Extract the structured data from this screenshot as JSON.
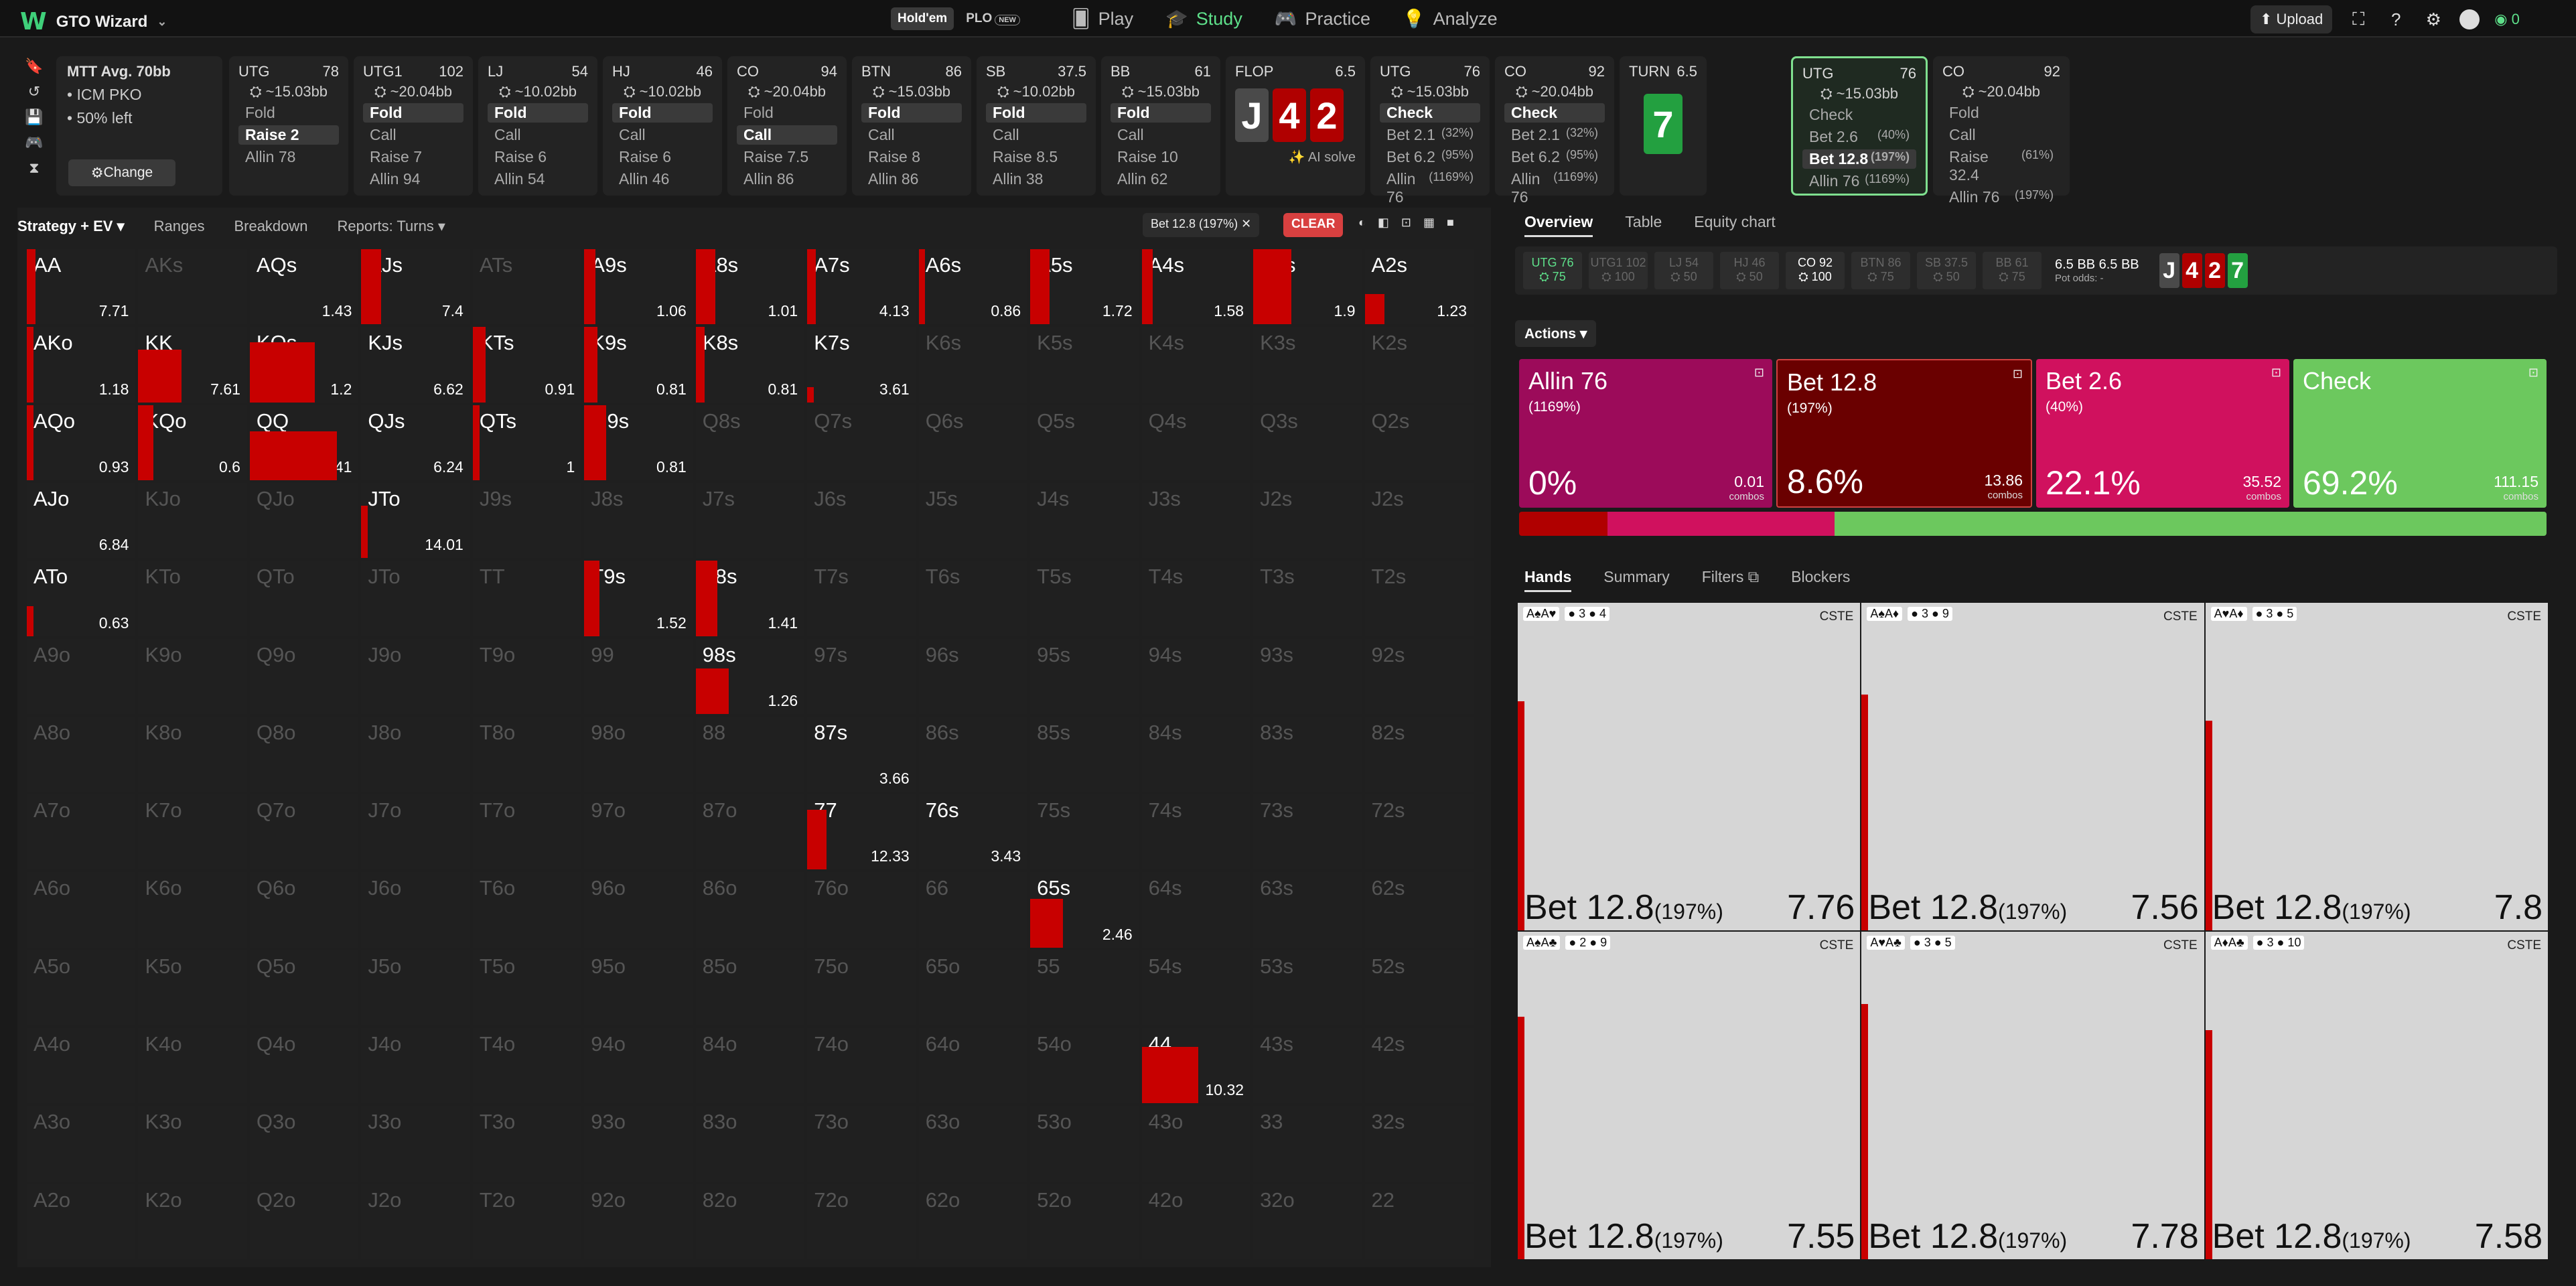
{
  "app": {
    "name": "GTO Wizard"
  },
  "gametype": {
    "holdem": "Hold'em",
    "plo": "PLO",
    "plo_tag": "NEW"
  },
  "nav": {
    "play": "Play",
    "study": "Study",
    "practice": "Practice",
    "analyze": "Analyze"
  },
  "topright": {
    "upload": "Upload",
    "coins": "0"
  },
  "mtt": {
    "title": "MTT Avg. 70bb",
    "line1": "ICM PKO",
    "line2": "50% left",
    "change": "Change"
  },
  "seats": [
    {
      "pos": "UTG",
      "num": "78",
      "stack": "~15.03bb",
      "opts": [
        {
          "l": "Fold"
        },
        {
          "l": "Raise 2",
          "sel": true
        },
        {
          "l": "Allin 78"
        }
      ]
    },
    {
      "pos": "UTG1",
      "num": "102",
      "stack": "~20.04bb",
      "opts": [
        {
          "l": "Fold",
          "sel": true
        },
        {
          "l": "Call"
        },
        {
          "l": "Raise 7"
        },
        {
          "l": "Allin 94"
        }
      ]
    },
    {
      "pos": "LJ",
      "num": "54",
      "stack": "~10.02bb",
      "opts": [
        {
          "l": "Fold",
          "sel": true
        },
        {
          "l": "Call"
        },
        {
          "l": "Raise 6"
        },
        {
          "l": "Allin 54"
        }
      ]
    },
    {
      "pos": "HJ",
      "num": "46",
      "stack": "~10.02bb",
      "opts": [
        {
          "l": "Fold",
          "sel": true
        },
        {
          "l": "Call"
        },
        {
          "l": "Raise 6"
        },
        {
          "l": "Allin 46"
        }
      ]
    },
    {
      "pos": "CO",
      "num": "94",
      "stack": "~20.04bb",
      "opts": [
        {
          "l": "Fold"
        },
        {
          "l": "Call",
          "sel": true
        },
        {
          "l": "Raise 7.5"
        },
        {
          "l": "Allin 86"
        }
      ]
    },
    {
      "pos": "BTN",
      "num": "86",
      "stack": "~15.03bb",
      "opts": [
        {
          "l": "Fold",
          "sel": true
        },
        {
          "l": "Call"
        },
        {
          "l": "Raise 8"
        },
        {
          "l": "Allin 86"
        }
      ]
    },
    {
      "pos": "SB",
      "num": "37.5",
      "stack": "~10.02bb",
      "opts": [
        {
          "l": "Fold",
          "sel": true
        },
        {
          "l": "Call"
        },
        {
          "l": "Raise 8.5"
        },
        {
          "l": "Allin 38"
        }
      ]
    },
    {
      "pos": "BB",
      "num": "61",
      "stack": "~15.03bb",
      "opts": [
        {
          "l": "Fold",
          "sel": true
        },
        {
          "l": "Call"
        },
        {
          "l": "Raise 10"
        },
        {
          "l": "Allin 62"
        }
      ]
    }
  ],
  "flop": {
    "label": "FLOP",
    "pot": "6.5",
    "cards": [
      "J",
      "4",
      "2"
    ],
    "aisolve": "AI solve"
  },
  "seats2": [
    {
      "pos": "UTG",
      "num": "76",
      "stack": "~15.03bb",
      "opts": [
        {
          "l": "Check",
          "sel": true
        },
        {
          "l": "Bet 2.1",
          "p": "(32%)"
        },
        {
          "l": "Bet 6.2",
          "p": "(95%)"
        },
        {
          "l": "Allin 76",
          "p": "(1169%)"
        }
      ]
    },
    {
      "pos": "CO",
      "num": "92",
      "stack": "~20.04bb",
      "opts": [
        {
          "l": "Check",
          "sel": true
        },
        {
          "l": "Bet 2.1",
          "p": "(32%)"
        },
        {
          "l": "Bet 6.2",
          "p": "(95%)"
        },
        {
          "l": "Allin 76",
          "p": "(1169%)"
        }
      ]
    }
  ],
  "turn": {
    "label": "TURN",
    "pot": "6.5",
    "card": "7"
  },
  "seats3": [
    {
      "pos": "UTG",
      "num": "76",
      "stack": "~15.03bb",
      "active": true,
      "opts": [
        {
          "l": "Check"
        },
        {
          "l": "Bet 2.6",
          "p": "(40%)"
        },
        {
          "l": "Bet 12.8",
          "p": "(197%)",
          "sel": true
        },
        {
          "l": "Allin 76",
          "p": "(1169%)"
        }
      ]
    },
    {
      "pos": "CO",
      "num": "92",
      "stack": "~20.04bb",
      "opts": [
        {
          "l": "Fold"
        },
        {
          "l": "Call"
        },
        {
          "l": "Raise 32.4",
          "p": "(61%)"
        },
        {
          "l": "Allin 76",
          "p": "(197%)"
        }
      ]
    }
  ],
  "lefttabs": {
    "strategy": "Strategy + EV",
    "ranges": "Ranges",
    "breakdown": "Breakdown",
    "reports": "Reports: Turns"
  },
  "filterchip": "Bet 12.8 (197%)",
  "clear": "CLEAR",
  "grid": [
    [
      "AA:7.71:100:8",
      "AKs",
      "AQs:1.43",
      "AJs:7.4:100:18",
      "ATs",
      "A9s:1.06:100:10",
      "A8s:1.01:100:18",
      "A7s:4.13:100:8",
      "A6s:0.86:100:6",
      "A5s:1.72:100:18",
      "A4s:1.58:100:10",
      "A3s:1.9:100:35",
      "A2s:1.23:40:18"
    ],
    [
      "AKo:1.18:100:6",
      "KK:7.61:70:40",
      "KQs:1.2:80:60",
      "KJs:6.62",
      "KTs:0.91:100:12",
      "K9s:0.81:100:12",
      "K8s:0.81:100:8",
      "K7s:3.61:20:6",
      "K6s",
      "K5s",
      "K4s",
      "K3s",
      "K2s"
    ],
    [
      "AQo:0.93:100:6",
      "KQo:0.6:100:14",
      "QQ:7.41:65:80",
      "QJs:6.24",
      "QTs:1:100:6",
      "Q9s:0.81:100:20",
      "Q8s",
      "Q7s",
      "Q6s",
      "Q5s",
      "Q4s",
      "Q3s",
      "Q2s"
    ],
    [
      "AJo:6.84",
      "KJo",
      "QJo",
      "JTo:14.01:70:6",
      "J9s",
      "J8s",
      "J7s",
      "J6s",
      "J5s",
      "J4s",
      "J3s",
      "J2s",
      "J2s"
    ],
    [
      "ATo:0.63:40:6",
      "KTo",
      "QTo",
      "JTo",
      "TT",
      "T9s:1.52:100:14",
      "T8s:1.41:100:20",
      "T7s",
      "T6s",
      "T5s",
      "T4s",
      "T3s",
      "T2s"
    ],
    [
      "A9o",
      "K9o",
      "Q9o",
      "J9o",
      "T9o",
      "99",
      "98s:1.26:60:30",
      "97s",
      "96s",
      "95s",
      "94s",
      "93s",
      "92s"
    ],
    [
      "A8o",
      "K8o",
      "Q8o",
      "J8o",
      "T8o",
      "98o",
      "88",
      "87s:3.66",
      "86s",
      "85s",
      "84s",
      "83s",
      "82s"
    ],
    [
      "A7o",
      "K7o",
      "Q7o",
      "J7o",
      "T7o",
      "97o",
      "87o",
      "77:12.33:80:18",
      "76s:3.43",
      "75s",
      "74s",
      "73s",
      "72s"
    ],
    [
      "A6o",
      "K6o",
      "Q6o",
      "J6o",
      "T6o",
      "96o",
      "86o",
      "76o",
      "66",
      "65s:2.46:65:30",
      "64s",
      "63s",
      "62s"
    ],
    [
      "A5o",
      "K5o",
      "Q5o",
      "J5o",
      "T5o",
      "95o",
      "85o",
      "75o",
      "65o",
      "55",
      "54s",
      "53s",
      "52s"
    ],
    [
      "A4o",
      "K4o",
      "Q4o",
      "J4o",
      "T4o",
      "94o",
      "84o",
      "74o",
      "64o",
      "54o",
      "44:10.32:75:52",
      "43s",
      "42s"
    ],
    [
      "A3o",
      "K3o",
      "Q3o",
      "J3o",
      "T3o",
      "93o",
      "83o",
      "73o",
      "63o",
      "53o",
      "43o",
      "33",
      "32s"
    ],
    [
      "A2o",
      "K2o",
      "Q2o",
      "J2o",
      "T2o",
      "92o",
      "82o",
      "72o",
      "62o",
      "52o",
      "42o",
      "32o",
      "22"
    ]
  ],
  "righttabs": {
    "overview": "Overview",
    "table": "Table",
    "equity": "Equity chart"
  },
  "strip": [
    {
      "p": "UTG 76",
      "s": "75",
      "cls": "utg"
    },
    {
      "p": "UTG1 102",
      "s": "100"
    },
    {
      "p": "LJ 54",
      "s": "50"
    },
    {
      "p": "HJ 46",
      "s": "50"
    },
    {
      "p": "CO 92",
      "s": "100",
      "cls": "on"
    },
    {
      "p": "BTN 86",
      "s": "75"
    },
    {
      "p": "SB 37.5",
      "s": "50"
    },
    {
      "p": "BB 61",
      "s": "75"
    }
  ],
  "pot": {
    "a": "6.5 BB",
    "b": "6.5 BB",
    "odds": "Pot odds: -"
  },
  "board": [
    "J",
    "4",
    "2",
    "7"
  ],
  "actions_label": "Actions",
  "action_cards": [
    {
      "name": "Allin 76",
      "sub": "(1169%)",
      "freq": "0%",
      "combos": "0.01",
      "color": "#9c0b5a"
    },
    {
      "name": "Bet 12.8",
      "sub": "(197%)",
      "freq": "8.6%",
      "combos": "13.86",
      "color": "#6a0000"
    },
    {
      "name": "Bet 2.6",
      "sub": "(40%)",
      "freq": "22.1%",
      "combos": "35.52",
      "color": "#d0115e"
    },
    {
      "name": "Check",
      "sub": "",
      "freq": "69.2%",
      "combos": "111.15",
      "color": "#6cc85e"
    }
  ],
  "combos_word": "combos",
  "freqbar": [
    {
      "c": "#b00000",
      "w": 8.6
    },
    {
      "c": "#d0115e",
      "w": 22.1
    },
    {
      "c": "#6cc85e",
      "w": 69.3
    }
  ],
  "handtabs": {
    "hands": "Hands",
    "summary": "Summary",
    "filters": "Filters",
    "blockers": "Blockers"
  },
  "hands": [
    {
      "cards": "A♠A♥",
      "b1": "3",
      "b2": "4",
      "cste": "CSTE",
      "name": "Bet 12.8",
      "pct": "(197%)",
      "ev": "7.76",
      "freq": 70
    },
    {
      "cards": "A♠A♦",
      "b1": "3",
      "b2": "9",
      "cste": "CSTE",
      "name": "Bet 12.8",
      "pct": "(197%)",
      "ev": "7.56",
      "freq": 72
    },
    {
      "cards": "A♥A♦",
      "b1": "3",
      "b2": "5",
      "cste": "CSTE",
      "name": "Bet 12.8",
      "pct": "(197%)",
      "ev": "7.8",
      "freq": 64
    },
    {
      "cards": "A♠A♣",
      "b1": "2",
      "b2": "9",
      "cste": "CSTE",
      "name": "Bet 12.8",
      "pct": "(197%)",
      "ev": "7.55",
      "freq": 74
    },
    {
      "cards": "A♥A♣",
      "b1": "3",
      "b2": "5",
      "cste": "CSTE",
      "name": "Bet 12.8",
      "pct": "(197%)",
      "ev": "7.78",
      "freq": 78
    },
    {
      "cards": "A♦A♣",
      "b1": "3",
      "b2": "10",
      "cste": "CSTE",
      "name": "Bet 12.8",
      "pct": "(197%)",
      "ev": "7.58",
      "freq": 70
    }
  ]
}
